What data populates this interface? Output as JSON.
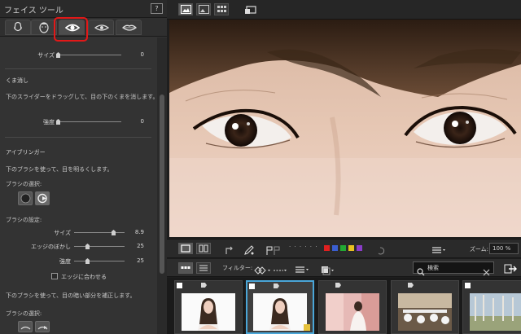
{
  "left_panel": {
    "title": "フェイス ツール",
    "help_label": "?",
    "tabs": [
      "face-shape",
      "skin",
      "eye",
      "eye-white",
      "lips"
    ],
    "active_tab": "eye",
    "size_top": {
      "label": "サイズ",
      "value": "0"
    },
    "kuma": {
      "heading": "くま消し",
      "desc": "下のスライダーをドラッグして、目の下のくまを消します。",
      "strength": {
        "label": "強度",
        "value": "0"
      }
    },
    "eyebrighten": {
      "heading": "アイブリンガー",
      "desc": "下のブラシを使って、目を明るくします。",
      "brush_select_label": "ブラシの選択:",
      "brush_settings_label": "ブラシの設定:",
      "size": {
        "label": "サイズ",
        "value": "8.9"
      },
      "feather": {
        "label": "エッジのぼかし",
        "value": "25"
      },
      "strength": {
        "label": "強度",
        "value": "25"
      },
      "fit_edge_label": "エッジに合わせる",
      "desc2": "下のブラシを使って、目の暗い部分を補正します。",
      "brush_select_label2": "ブラシの選択:"
    }
  },
  "view_toolbar": {
    "dots": "· · · · · ·",
    "colors": [
      "#e02020",
      "#3a5ed0",
      "#22aa33",
      "#e8c020",
      "#8a3cc8"
    ],
    "zoom_label": "ズーム:",
    "zoom_value": "100 %"
  },
  "filter_toolbar": {
    "filter_label": "フィルター:",
    "search_value": "検索"
  },
  "accent": "#4aa6d8"
}
